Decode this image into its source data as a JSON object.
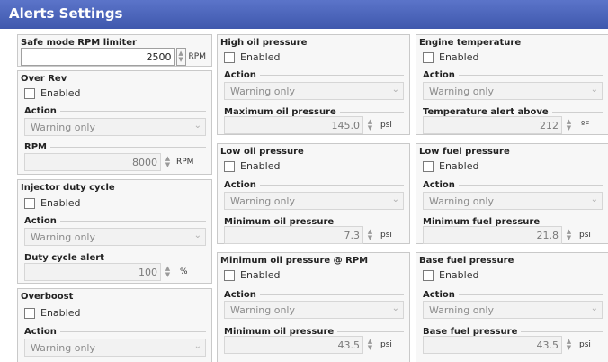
{
  "title": "Alerts Settings",
  "safe_mode": {
    "label": "Safe mode RPM limiter",
    "value": "2500",
    "unit": "RPM"
  },
  "over_rev": {
    "title": "Over Rev",
    "enabled": "Enabled",
    "action_label": "Action",
    "action_value": "Warning only",
    "rpm_label": "RPM",
    "rpm_value": "8000",
    "rpm_unit": "RPM"
  },
  "injector": {
    "title": "Injector duty cycle",
    "enabled": "Enabled",
    "action_label": "Action",
    "action_value": "Warning only",
    "alert_label": "Duty cycle alert",
    "alert_value": "100",
    "alert_unit": "%"
  },
  "overboost": {
    "title": "Overboost",
    "enabled": "Enabled",
    "action_label": "Action",
    "action_value": "Warning only"
  },
  "high_oil": {
    "title": "High oil pressure",
    "enabled": "Enabled",
    "action_label": "Action",
    "action_value": "Warning only",
    "value_label": "Maximum oil pressure",
    "value": "145.0",
    "unit": "psi"
  },
  "low_oil": {
    "title": "Low oil pressure",
    "enabled": "Enabled",
    "action_label": "Action",
    "action_value": "Warning only",
    "value_label": "Minimum oil pressure",
    "value": "7.3",
    "unit": "psi"
  },
  "min_oil_rpm": {
    "title": "Minimum oil pressure @ RPM",
    "enabled": "Enabled",
    "action_label": "Action",
    "action_value": "Warning only",
    "value_label": "Minimum oil pressure",
    "value": "43.5",
    "unit": "psi"
  },
  "engine_temp": {
    "title": "Engine temperature",
    "enabled": "Enabled",
    "action_label": "Action",
    "action_value": "Warning only",
    "value_label": "Temperature alert above",
    "value": "212",
    "unit": "ºF"
  },
  "low_fuel": {
    "title": "Low fuel pressure",
    "enabled": "Enabled",
    "action_label": "Action",
    "action_value": "Warning only",
    "value_label": "Minimum fuel pressure",
    "value": "21.8",
    "unit": "psi"
  },
  "base_fuel": {
    "title": "Base fuel pressure",
    "enabled": "Enabled",
    "action_label": "Action",
    "action_value": "Warning only",
    "value_label": "Base fuel pressure",
    "value": "43.5",
    "unit": "psi"
  },
  "icons": {
    "spin_up": "▲",
    "spin_down": "▼",
    "dropdown": "⌄"
  }
}
